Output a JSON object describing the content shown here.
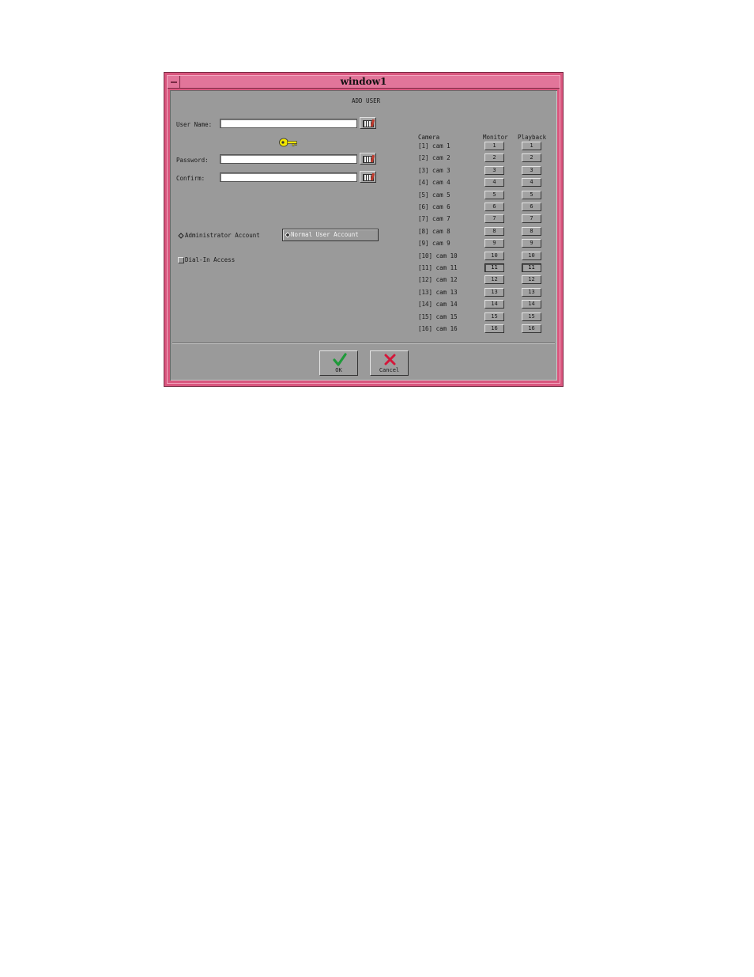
{
  "window": {
    "title": "window1"
  },
  "form": {
    "heading": "ADD USER",
    "username_label": "User Name:",
    "username_value": "",
    "password_label": "Password:",
    "password_value": "",
    "confirm_label": "Confirm:",
    "confirm_value": "",
    "admin_account_label": "Administrator Account",
    "normal_account_label": "Normal User Account",
    "selected_account": "Normal User Account",
    "dialin_label": "Dial-In Access",
    "dialin_checked": false
  },
  "cameras": {
    "header_camera": "Camera",
    "header_monitor": "Monitor",
    "header_playback": "Playback",
    "rows": [
      {
        "label": "[1] cam 1",
        "monitor": "1",
        "playback": "1"
      },
      {
        "label": "[2] cam 2",
        "monitor": "2",
        "playback": "2"
      },
      {
        "label": "[3] cam 3",
        "monitor": "3",
        "playback": "3"
      },
      {
        "label": "[4] cam 4",
        "monitor": "4",
        "playback": "4"
      },
      {
        "label": "[5] cam 5",
        "monitor": "5",
        "playback": "5"
      },
      {
        "label": "[6] cam 6",
        "monitor": "6",
        "playback": "6"
      },
      {
        "label": "[7] cam 7",
        "monitor": "7",
        "playback": "7"
      },
      {
        "label": "[8] cam 8",
        "monitor": "8",
        "playback": "8"
      },
      {
        "label": "[9] cam 9",
        "monitor": "9",
        "playback": "9"
      },
      {
        "label": "[10] cam 10",
        "monitor": "10",
        "playback": "10"
      },
      {
        "label": "[11] cam 11",
        "monitor": "11",
        "playback": "11"
      },
      {
        "label": "[12] cam 12",
        "monitor": "12",
        "playback": "12"
      },
      {
        "label": "[13] cam 13",
        "monitor": "13",
        "playback": "13"
      },
      {
        "label": "[14] cam 14",
        "monitor": "14",
        "playback": "14"
      },
      {
        "label": "[15] cam 15",
        "monitor": "15",
        "playback": "15"
      },
      {
        "label": "[16] cam 16",
        "monitor": "16",
        "playback": "16"
      }
    ]
  },
  "buttons": {
    "ok_label": "OK",
    "cancel_label": "Cancel"
  },
  "icons": {
    "key": "key-icon",
    "keyboard": "keyboard-icon",
    "ok": "checkmark-icon",
    "cancel": "cross-icon"
  },
  "colors": {
    "title_bar": "#e2759a",
    "frame": "#d9567e",
    "client_bg": "#9a9a9a",
    "ok_check": "#1f9a3a",
    "cancel_x": "#d4173a",
    "key": "#f2e600"
  }
}
